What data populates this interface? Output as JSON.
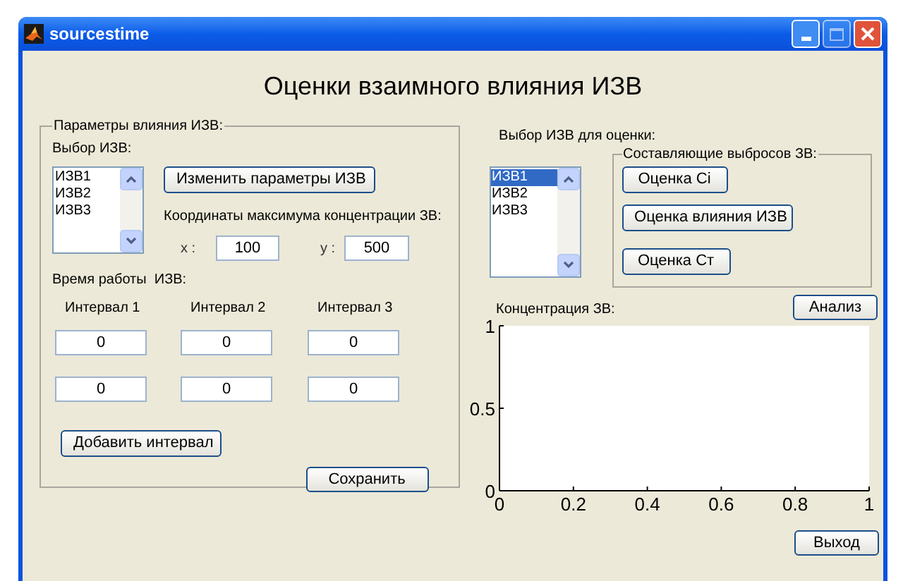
{
  "window": {
    "title": "sourcestime"
  },
  "heading": "Оценки взаимного влияния ИЗВ",
  "parameters_panel": {
    "title": "Параметры влияния ИЗВ:",
    "source_label": "Выбор ИЗВ:",
    "sources": [
      {
        "label": "ИЗВ1",
        "selected": false
      },
      {
        "label": "ИЗВ2",
        "selected": false
      },
      {
        "label": "ИЗВ3",
        "selected": false
      }
    ],
    "change_button": "Изменить параметры ИЗВ",
    "coords_label": "Координаты максимума концентрации ЗВ:",
    "x_label": "x :",
    "x_value": "100",
    "y_label": "y :",
    "y_value": "500",
    "work_time_label": "Время работы  ИЗВ:",
    "intervals": [
      {
        "label": "Интервал 1",
        "values": [
          "0",
          "0"
        ]
      },
      {
        "label": "Интервал 2",
        "values": [
          "0",
          "0"
        ]
      },
      {
        "label": "Интервал 3",
        "values": [
          "0",
          "0"
        ]
      }
    ],
    "add_button": "Добавить интервал",
    "save_button": "Сохранить"
  },
  "evaluation": {
    "source_label": "Выбор ИЗВ для оценки:",
    "sources": [
      {
        "label": "ИЗВ1",
        "selected": true
      },
      {
        "label": "ИЗВ2",
        "selected": false
      },
      {
        "label": "ИЗВ3",
        "selected": false
      }
    ],
    "components_panel": {
      "title": "Составляющие выбросов ЗВ:",
      "buttons": [
        "Оценка Ci",
        "Оценка влияния ИЗВ",
        "Оценка Ст"
      ]
    },
    "concentration_label": "Концентрация ЗВ:",
    "analyze_button": "Анализ",
    "chart_data": {
      "type": "line",
      "xlim": [
        0,
        1
      ],
      "ylim": [
        0,
        1
      ],
      "xticks": [
        0,
        0.2,
        0.4,
        0.6,
        0.8,
        1
      ],
      "yticks": [
        0,
        0.5,
        1
      ]
    },
    "exit_button": "Выход"
  }
}
